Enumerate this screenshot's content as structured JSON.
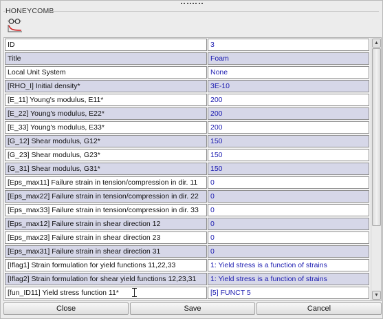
{
  "panel": {
    "group_title": "HONEYCOMB",
    "toolbar_icon": "material-curve-icon"
  },
  "properties": [
    {
      "label": "ID",
      "value": "3"
    },
    {
      "label": "Title",
      "value": "Foam"
    },
    {
      "label": "Local Unit System",
      "value": "None"
    },
    {
      "label": "[RHO_I] Initial density*",
      "value": "3E-10"
    },
    {
      "label": "[E_11] Young's modulus, E11*",
      "value": "200"
    },
    {
      "label": "[E_22] Young's modulus, E22*",
      "value": "200"
    },
    {
      "label": "[E_33] Young's modulus, E33*",
      "value": "200"
    },
    {
      "label": "[G_12] Shear modulus, G12*",
      "value": "150"
    },
    {
      "label": "[G_23] Shear modulus, G23*",
      "value": "150"
    },
    {
      "label": "[G_31] Shear modulus, G31*",
      "value": "150"
    },
    {
      "label": "[Eps_max11] Failure strain in tension/compression in dir. 11",
      "value": "0"
    },
    {
      "label": "[Eps_max22] Failure strain in tension/compression in dir. 22",
      "value": "0"
    },
    {
      "label": "[Eps_max33] Failure strain in tension/compression in dir. 33",
      "value": "0"
    },
    {
      "label": "[Eps_max12] Failure strain in shear direction 12",
      "value": "0"
    },
    {
      "label": "[Eps_max23] Failure strain in shear direction 23",
      "value": "0"
    },
    {
      "label": "[Eps_max31] Failure strain in shear direction 31",
      "value": "0"
    },
    {
      "label": "[Iflag1] Strain formulation for yield functions 11,22,33",
      "value": "1: Yield stress is a function of strains"
    },
    {
      "label": "[Iflag2] Strain formulation for shear yield functions 12,23,31",
      "value": "1: Yield stress is a function of strains"
    },
    {
      "label": "[fun_ID11] Yield stress function 11*",
      "value": "[5] FUNCT 5"
    }
  ],
  "scrollbar": {
    "up_icon": "arrow-up-icon",
    "down_icon": "arrow-down-icon"
  },
  "buttons": {
    "close": "Close",
    "save": "Save",
    "cancel": "Cancel"
  },
  "colors": {
    "value_text": "#1c1cb0",
    "row_alt": "#d6d7e8"
  }
}
